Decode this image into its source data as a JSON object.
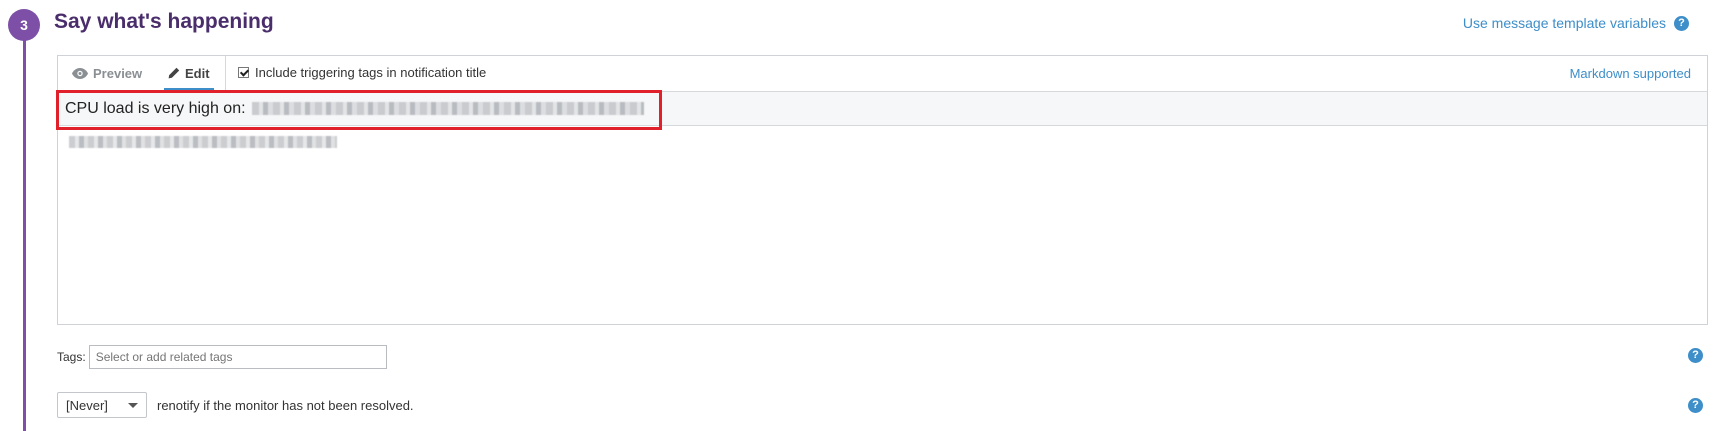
{
  "step": {
    "number": "3",
    "title": "Say what's happening"
  },
  "links": {
    "template_variables": "Use message template variables",
    "markdown": "Markdown supported"
  },
  "editor": {
    "tabs": [
      {
        "label": "Preview",
        "icon": "eye-icon",
        "active": false
      },
      {
        "label": "Edit",
        "icon": "pencil-icon",
        "active": true
      }
    ],
    "include_tags_label": "Include triggering tags in notification title",
    "include_tags_checked": true,
    "title_value": "CPU load is very high on:"
  },
  "tags": {
    "label": "Tags:",
    "placeholder": "Select or add related tags"
  },
  "renotify": {
    "selected": "[Never]",
    "text": "renotify if the monitor has not been resolved."
  },
  "colors": {
    "accent_purple": "#7d4fa6",
    "link_blue": "#3d8ec9",
    "highlight_red": "#e0202b"
  }
}
